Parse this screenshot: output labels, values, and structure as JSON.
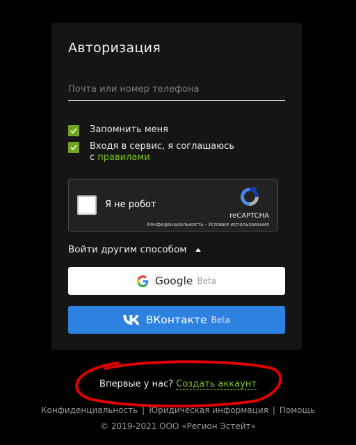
{
  "auth": {
    "title": "Авторизация",
    "login_placeholder": "Почта или номер телефона",
    "login_value": "",
    "remember_label": "Запомнить меня",
    "remember_checked": true,
    "terms_prefix": "Входя в сервис, я соглашаюсь",
    "terms_prefix2": "с ",
    "terms_link": "правилами",
    "terms_checked": true
  },
  "captcha": {
    "label": "Я не робот",
    "brand": "reCAPTCHA",
    "privacy": "Конфиденциальность",
    "terms": "Условия использования",
    "links_sep": " - "
  },
  "other_login": {
    "label": "Войти другим способом",
    "google_label": "Google",
    "google_badge": "Beta",
    "vk_label": "ВКонтакте",
    "vk_badge": "Beta"
  },
  "signup": {
    "prompt": "Впервые у нас?",
    "link": "Создать аккаунт"
  },
  "footer": {
    "privacy": "Конфиденциальность",
    "legal": "Юридическая информация",
    "help": "Помощь",
    "separator": "|",
    "copyright": "© 2019-2021 ООО «Регион Эстейт»"
  },
  "colors": {
    "accent_green": "#7cc31f",
    "vk_blue": "#2d81e0",
    "annotation_red": "#e00000"
  }
}
